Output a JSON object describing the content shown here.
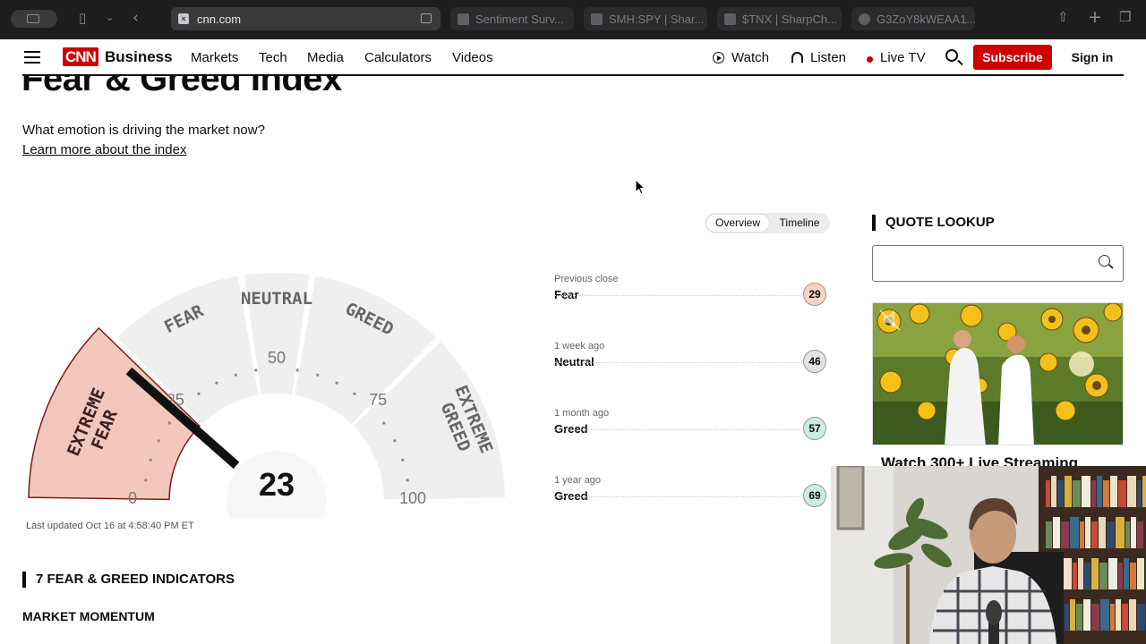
{
  "browser": {
    "url": "cnn.com",
    "tabs": [
      {
        "title": "Sentiment Surv..."
      },
      {
        "title": "SMH:SPY | Shar..."
      },
      {
        "title": "$TNX | SharpCh..."
      },
      {
        "title": "G3ZoY8kWEAA1..."
      }
    ]
  },
  "nav": {
    "brand": "CNN",
    "section": "Business",
    "links": [
      "Markets",
      "Tech",
      "Media",
      "Calculators",
      "Videos"
    ],
    "watch": "Watch",
    "listen": "Listen",
    "live_tv": "Live TV",
    "subscribe": "Subscribe",
    "sign_in": "Sign in"
  },
  "page": {
    "title": "Fear & Greed Index",
    "subtitle": "What emotion is driving the market now?",
    "learn_more": "Learn more about the index"
  },
  "toggle": {
    "overview": "Overview",
    "timeline": "Timeline"
  },
  "gauge": {
    "value": 23,
    "value_label": "23",
    "zones": [
      "EXTREME FEAR",
      "FEAR",
      "NEUTRAL",
      "GREED",
      "EXTREME GREED"
    ],
    "zone_lines": {
      "extreme_fear": [
        "EXTREME",
        "FEAR"
      ],
      "fear": "FEAR",
      "neutral": "NEUTRAL",
      "greed": "GREED",
      "extreme_greed": [
        "EXTREME",
        "GREED"
      ]
    },
    "ticks": [
      "0",
      "25",
      "50",
      "75",
      "100"
    ],
    "active_color": "#f2c8bc",
    "active_border": "#7a1a1a"
  },
  "last_updated": "Last updated Oct 16 at 4:58:40 PM ET",
  "history": [
    {
      "label": "Previous close",
      "rating": "Fear",
      "value": "29",
      "color": "#f6d2c1"
    },
    {
      "label": "1 week ago",
      "rating": "Neutral",
      "value": "46",
      "color": "#e3e3e3"
    },
    {
      "label": "1 month ago",
      "rating": "Greed",
      "value": "57",
      "color": "#c9ece4"
    },
    {
      "label": "1 year ago",
      "rating": "Greed",
      "value": "69",
      "color": "#c9ece4"
    }
  ],
  "indicators": {
    "heading": "7 FEAR & GREED INDICATORS",
    "first": "MARKET MOMENTUM"
  },
  "quote_lookup": {
    "heading": "QUOTE LOOKUP",
    "value": ""
  },
  "video": {
    "caption": "Watch 300+ Live Streaming"
  }
}
